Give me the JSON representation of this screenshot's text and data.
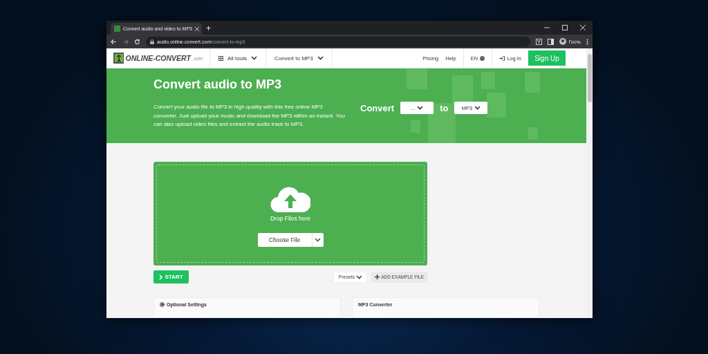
{
  "browser": {
    "tab_title": "Convert audio and video to MP3",
    "new_tab": "+",
    "url_host": "audio.online-convert.com",
    "url_path": "/convert-to-mp3",
    "profile": "Гость"
  },
  "nav": {
    "logo_text": "ONLINE-CONVERT",
    "logo_suffix": ".com",
    "menus": [
      {
        "label": "All tools",
        "kind": "grid"
      },
      {
        "label": "Convert to MP3",
        "kind": "plain"
      }
    ],
    "links": [
      "Pricing",
      "Help"
    ],
    "language": "EN",
    "login": "Log In",
    "signup": "Sign Up"
  },
  "hero": {
    "title": "Convert audio to MP3",
    "description": "Convert your audio file to MP3 in high quality with this free online MP3 converter. Just upload your music and download the MP3 within an instant. You can also upload video files and extract the audio track to MP3.",
    "convert_label": "Convert",
    "from_select": "...",
    "to_label": "to",
    "to_select": "MP3"
  },
  "upload": {
    "drop_text": "Drop Files here",
    "choose_button": "Choose File"
  },
  "actions": {
    "start": "START",
    "presets": "Presets",
    "add_example": "ADD EXAMPLE FILE"
  },
  "panels": [
    {
      "title": "Optional Settings",
      "kind": "settings"
    },
    {
      "title": "MP3 Converter",
      "kind": "plain"
    }
  ]
}
